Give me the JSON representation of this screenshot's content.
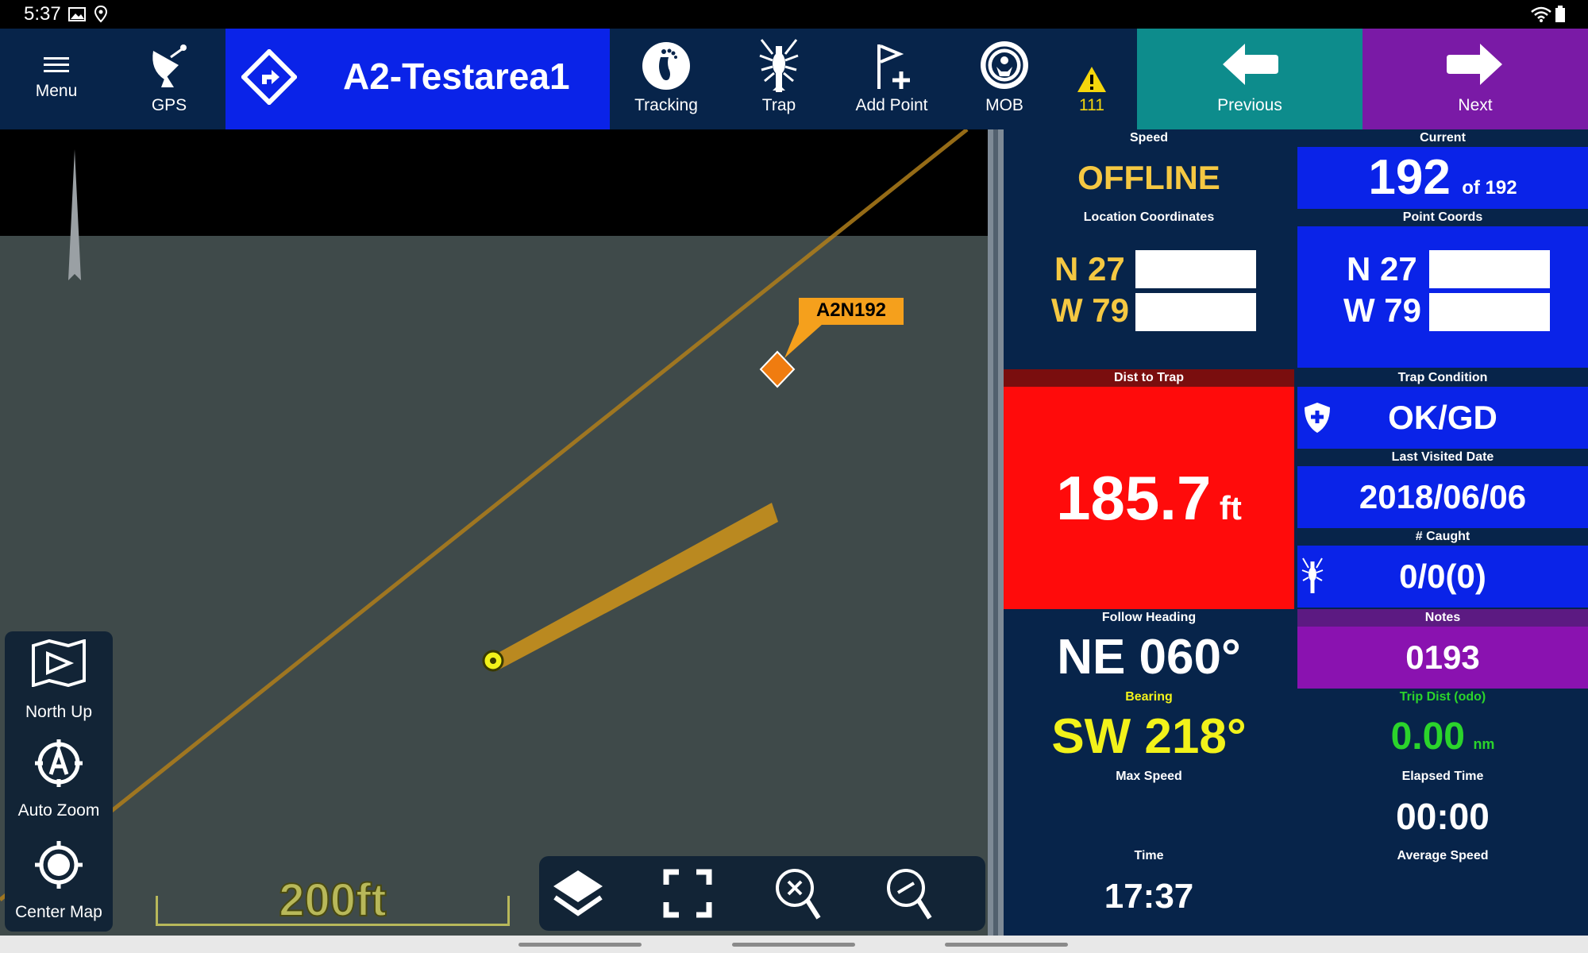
{
  "status_bar": {
    "time": "5:37"
  },
  "toolbar": {
    "menu_label": "Menu",
    "gps_label": "GPS",
    "route_title": "A2-Testarea1",
    "tracking_label": "Tracking",
    "trap_label": "Trap",
    "add_point_label": "Add Point",
    "mob_label": "MOB",
    "alert_count": "111",
    "previous_label": "Previous",
    "next_label": "Next"
  },
  "map": {
    "marker_label": "A2N192",
    "scale_text": "200ft",
    "north_up_label": "North Up",
    "auto_zoom_label": "Auto Zoom",
    "center_map_label": "Center Map"
  },
  "panel": {
    "speed": {
      "header": "Speed",
      "value": "OFFLINE"
    },
    "current": {
      "header": "Current",
      "value": "192",
      "suffix": "of 192"
    },
    "location": {
      "header": "Location Coordinates",
      "lat": "N 27",
      "lon": "W 79"
    },
    "point_coords": {
      "header": "Point Coords",
      "lat": "N 27",
      "lon": "W 79"
    },
    "dist_to_trap": {
      "header": "Dist to Trap",
      "value": "185.7",
      "unit": "ft"
    },
    "trap_condition": {
      "header": "Trap Condition",
      "value": "OK/GD"
    },
    "last_visited": {
      "header": "Last Visited Date",
      "value": "2018/06/06"
    },
    "caught": {
      "header": "# Caught",
      "value": "0/0(0)"
    },
    "follow_heading": {
      "header": "Follow Heading",
      "value": "NE 060°"
    },
    "notes": {
      "header": "Notes",
      "value": "0193"
    },
    "bearing": {
      "header": "Bearing",
      "value": "SW 218°"
    },
    "trip_dist": {
      "header": "Trip Dist (odo)",
      "value": "0.00",
      "unit": "nm"
    },
    "max_speed": {
      "header": "Max Speed",
      "value": ""
    },
    "elapsed": {
      "header": "Elapsed Time",
      "value": "00:00"
    },
    "time": {
      "header": "Time",
      "value": "17:37"
    },
    "avg_speed": {
      "header": "Average Speed",
      "value": ""
    }
  },
  "colors": {
    "toolbar_bg": "#07244a",
    "route_blue": "#0a23e8",
    "previous_teal": "#0d8c8c",
    "next_purple": "#7a1aa6",
    "offline_yellow": "#f5c842",
    "dist_red": "#ff0b0b",
    "bearing_yellow": "#f2f21a",
    "trip_green": "#2bd42b"
  }
}
